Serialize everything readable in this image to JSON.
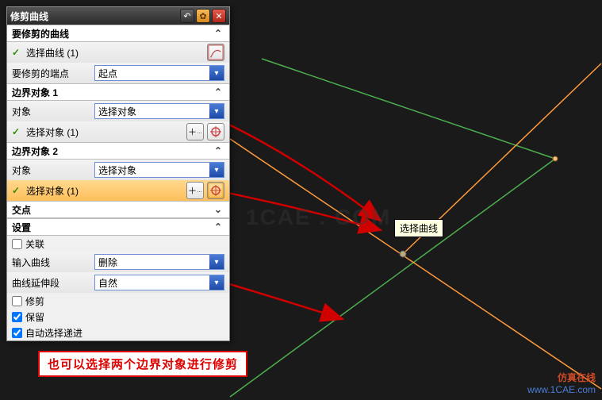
{
  "title": "修剪曲线",
  "sections": {
    "trimCurve": {
      "header": "要修剪的曲线",
      "selectCurve": "选择曲线 (1)",
      "endLabel": "要修剪的端点",
      "endValue": "起点"
    },
    "boundary1": {
      "header": "边界对象 1",
      "objectLabel": "对象",
      "objectValue": "选择对象",
      "selectObj": "选择对象 (1)"
    },
    "boundary2": {
      "header": "边界对象 2",
      "objectLabel": "对象",
      "objectValue": "选择对象",
      "selectObj": "选择对象 (1)"
    },
    "intersection": "交点",
    "settings": {
      "header": "设置",
      "assoc": "关联",
      "inputCurveLabel": "输入曲线",
      "inputCurveValue": "删除",
      "extendLabel": "曲线延伸段",
      "extendValue": "自然",
      "repair": "修剪",
      "keep": "保留",
      "autoSel": "自动选择递进"
    }
  },
  "tooltip": "选择曲线",
  "annotation": "也可以选择两个边界对象进行修剪",
  "watermark": {
    "line1": "仿真在线",
    "line2": "www.1CAE.com"
  },
  "bgwatermark": "1CAE . COM"
}
